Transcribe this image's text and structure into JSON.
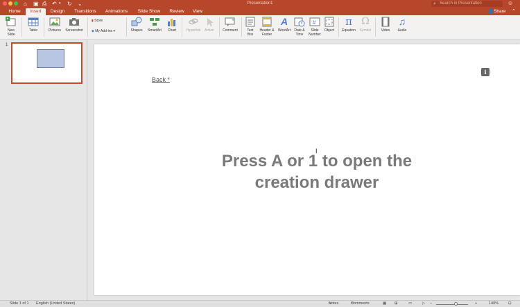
{
  "app": {
    "title": "Presentation1",
    "search_placeholder": "Search in Presentation",
    "share_label": "Share"
  },
  "tabs": [
    "Home",
    "Insert",
    "Design",
    "Transitions",
    "Animations",
    "Slide Show",
    "Review",
    "View"
  ],
  "active_tab": "Insert",
  "ribbon": {
    "new_slide": "New\nSlide",
    "table": "Table",
    "pictures": "Pictures",
    "screenshot": "Screenshot",
    "store": "Store",
    "my_addins": "My Add-ins",
    "shapes": "Shapes",
    "smartart": "SmartArt",
    "chart": "Chart",
    "hyperlink": "Hyperlink",
    "action": "Action",
    "comment": "Comment",
    "text_box": "Text\nBox",
    "header_footer": "Header &\nFooter",
    "wordart": "WordArt",
    "date_time": "Date &\nTime",
    "slide_number": "Slide\nNumber",
    "object": "Object",
    "equation": "Equation",
    "symbol": "Symbol",
    "video": "Video",
    "audio": "Audio"
  },
  "thumbnails": [
    {
      "number": "1"
    }
  ],
  "slide": {
    "back_link": "Back *",
    "message": "Press A or 1 to open the creation drawer",
    "info_glyph": "i"
  },
  "status": {
    "slide_info": "Slide 1 of 1",
    "language": "English (United States)",
    "notes": "Notes",
    "comments": "Comments",
    "zoom_level": "140%"
  },
  "colors": {
    "brand": "#b7472a",
    "thumb_border": "#c84a2c"
  }
}
